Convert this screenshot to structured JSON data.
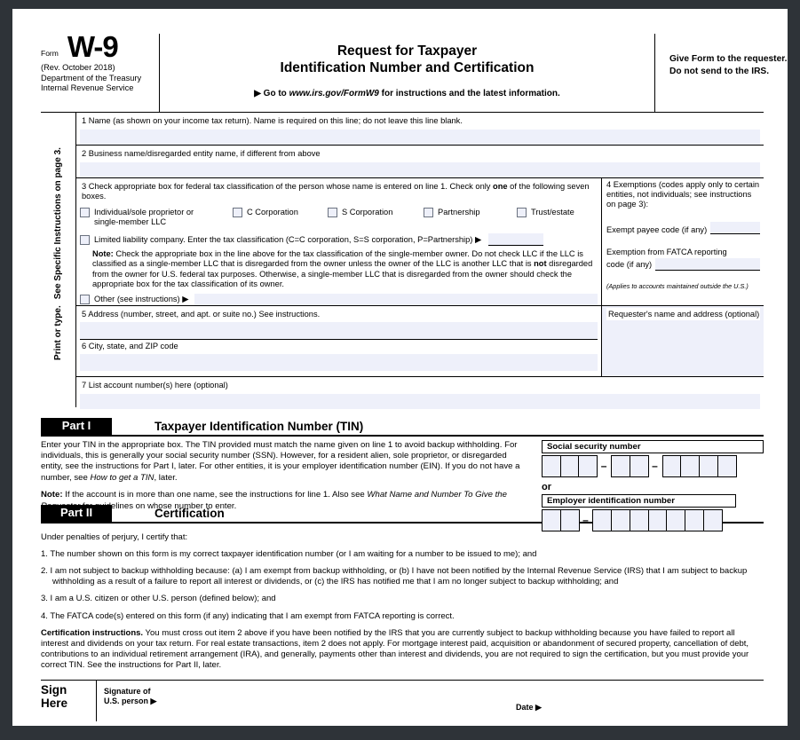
{
  "form": {
    "form_word": "Form",
    "form_number": "W-9",
    "revision": "(Rev. October 2018)",
    "department_line1": "Department of the Treasury",
    "department_line2": "Internal Revenue Service",
    "title_line1": "Request for Taxpayer",
    "title_line2": "Identification Number and Certification",
    "goto_prefix": "▶ Go to ",
    "goto_url": "www.irs.gov/FormW9",
    "goto_suffix": " for instructions and the latest information.",
    "give_form_note": "Give Form to the requester. Do not send to the IRS."
  },
  "side_rail": {
    "line1": "Print or type.",
    "line2": "See Specific Instructions on page 3."
  },
  "lines": {
    "line1_label": "1  Name (as shown on your income tax return). Name is required on this line; do not leave this line blank.",
    "line1_value": "",
    "line2_label": "2  Business name/disregarded entity name, if different from above",
    "line2_value": "",
    "line3_label_a": "3  Check appropriate box for federal tax classification of the person whose name is entered on line 1. Check only ",
    "line3_label_bold": "one",
    "line3_label_b": " of the following seven boxes.",
    "line5_label": "5  Address (number, street, and apt. or suite no.) See instructions.",
    "line5_value": "",
    "line6_label": "6  City, state, and ZIP code",
    "line6_value": "",
    "line7_label": "7  List account number(s) here (optional)",
    "line7_value": "",
    "requester_label": "Requester's name and address (optional)",
    "requester_value": ""
  },
  "classifications": [
    {
      "label_line1": "Individual/sole proprietor or",
      "label_line2": "single-member LLC",
      "checked": false
    },
    {
      "label_line1": "C Corporation",
      "label_line2": "",
      "checked": false
    },
    {
      "label_line1": "S Corporation",
      "label_line2": "",
      "checked": false
    },
    {
      "label_line1": "Partnership",
      "label_line2": "",
      "checked": false
    },
    {
      "label_line1": "Trust/estate",
      "label_line2": "",
      "checked": false
    }
  ],
  "llc": {
    "checked": false,
    "label": "Limited liability company. Enter the tax classification (C=C corporation, S=S corporation, P=Partnership) ▶",
    "entry_value": "",
    "note_bold": "Note:",
    "note_text": " Check the appropriate box in the line above for the tax classification of the single-member owner.  Do not check LLC if the LLC is classified as a single-member LLC that is disregarded from the owner unless the owner of the LLC is another LLC that is ",
    "note_bold2": "not",
    "note_text2": " disregarded from the owner for U.S. federal tax purposes. Otherwise, a single-member LLC that is disregarded from the owner should check the appropriate box for the tax classification of its owner."
  },
  "other": {
    "checked": false,
    "label": "Other (see instructions) ▶",
    "value": ""
  },
  "exemptions": {
    "title": "4  Exemptions (codes apply only to certain entities, not individuals; see instructions on page 3):",
    "payee_label": "Exempt payee code (if any)",
    "payee_value": "",
    "fatca_label_line1": "Exemption from FATCA reporting",
    "fatca_label_line2": "code (if any)",
    "fatca_value": "",
    "applies_note": "(Applies to accounts maintained outside the U.S.)"
  },
  "part1": {
    "tag": "Part I",
    "name": "Taxpayer Identification Number (TIN)",
    "paragraph1_a": "Enter your TIN in the appropriate box. The TIN provided must match the name given on line 1 to avoid backup withholding. For individuals, this is generally your social security number (SSN). However, for a resident alien, sole proprietor, or disregarded entity, see the instructions for Part I, later. For other entities, it is your employer identification number (EIN). If you do not have a number, see ",
    "paragraph1_italic": "How to get a TIN",
    "paragraph1_b": ", later.",
    "note_bold": "Note:",
    "note_a": " If the account is in more than one name, see the instructions for line 1. Also see ",
    "note_italic": "What Name and Number To Give the Requester",
    "note_b": " for guidelines on whose number to enter.",
    "ssn_label": "Social security number",
    "ssn_groups": [
      3,
      2,
      4
    ],
    "ssn_value": "",
    "or_label": "or",
    "ein_label": "Employer identification number",
    "ein_groups": [
      2,
      7
    ],
    "ein_value": "",
    "dash": "–"
  },
  "part2": {
    "tag": "Part II",
    "name": "Certification",
    "intro": "Under penalties of perjury, I certify that:",
    "items": [
      "1. The number shown on this form is my correct taxpayer identification number (or I am waiting for a number to be issued to me); and",
      "2. I am not subject to backup withholding because: (a) I am exempt from backup withholding, or (b) I have not been notified by the Internal Revenue Service (IRS) that I am subject to backup withholding as a result of a failure to report all interest or dividends, or (c) the IRS has notified me that I am no longer subject to backup withholding; and",
      "3. I am a U.S. citizen or other U.S. person (defined below); and",
      "4. The FATCA code(s) entered on this form (if any) indicating that I am exempt from FATCA reporting is correct."
    ],
    "cert_bold": "Certification instructions.",
    "cert_text": " You must cross out item 2 above if you have been notified by the IRS that you are currently subject to backup withholding because you have failed to report all interest and dividends on your tax return. For real estate transactions, item 2 does not apply. For mortgage interest paid, acquisition or abandonment of secured property, cancellation of debt, contributions to an individual retirement arrangement (IRA), and generally, payments other than interest and dividends, you are not required to sign the certification, but you must provide your correct TIN. See the instructions for Part II, later."
  },
  "sign": {
    "tag_line1": "Sign",
    "tag_line2": "Here",
    "signature_label_line1": "Signature of",
    "signature_label_line2": "U.S. person ▶",
    "signature_value": "",
    "date_label": "Date ▶",
    "date_value": ""
  },
  "colors": {
    "field_fill": "#eef0fa",
    "frame": "#2e3338",
    "ink": "#000000"
  }
}
